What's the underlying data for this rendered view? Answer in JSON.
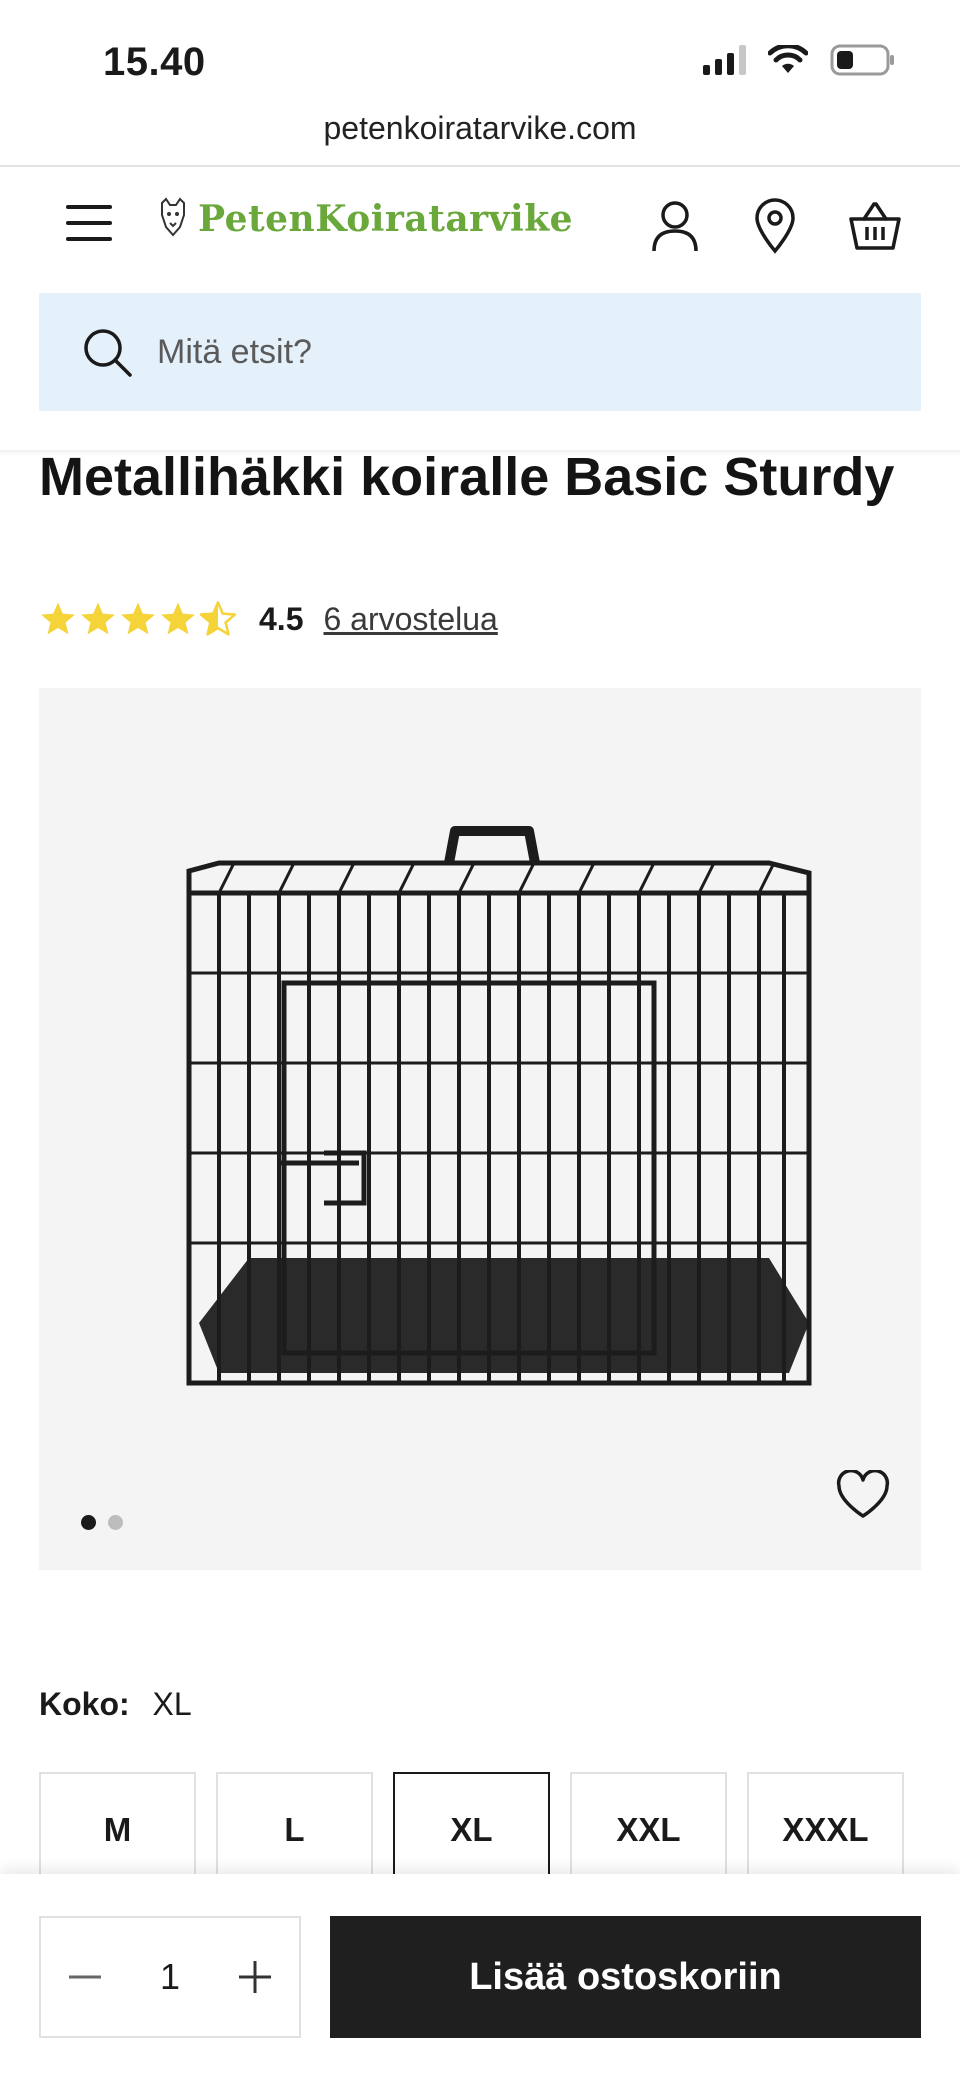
{
  "status_bar": {
    "time": "15.40"
  },
  "browser": {
    "url": "petenkoiratarvike.com"
  },
  "header": {
    "logo_text": "PetenKoiratarvike"
  },
  "search": {
    "placeholder": "Mitä etsit?"
  },
  "product": {
    "title": "Metallihäkki koiralle Basic Sturdy",
    "rating_value": "4.5",
    "rating_score": 4.5,
    "rating_max": 5,
    "reviews_label": "6 arvostelua",
    "image_count": 2,
    "active_image": 1
  },
  "size": {
    "label": "Koko:",
    "selected": "XL",
    "options": [
      "M",
      "L",
      "XL",
      "XXL",
      "XXXL"
    ]
  },
  "cart": {
    "quantity": "1",
    "add_label": "Lisää ostoskoriin"
  },
  "colors": {
    "brand_green": "#6aa83b",
    "star_yellow": "#f5d43a",
    "search_bg": "#e4f1fb",
    "button_dark": "#1f1f1f"
  }
}
